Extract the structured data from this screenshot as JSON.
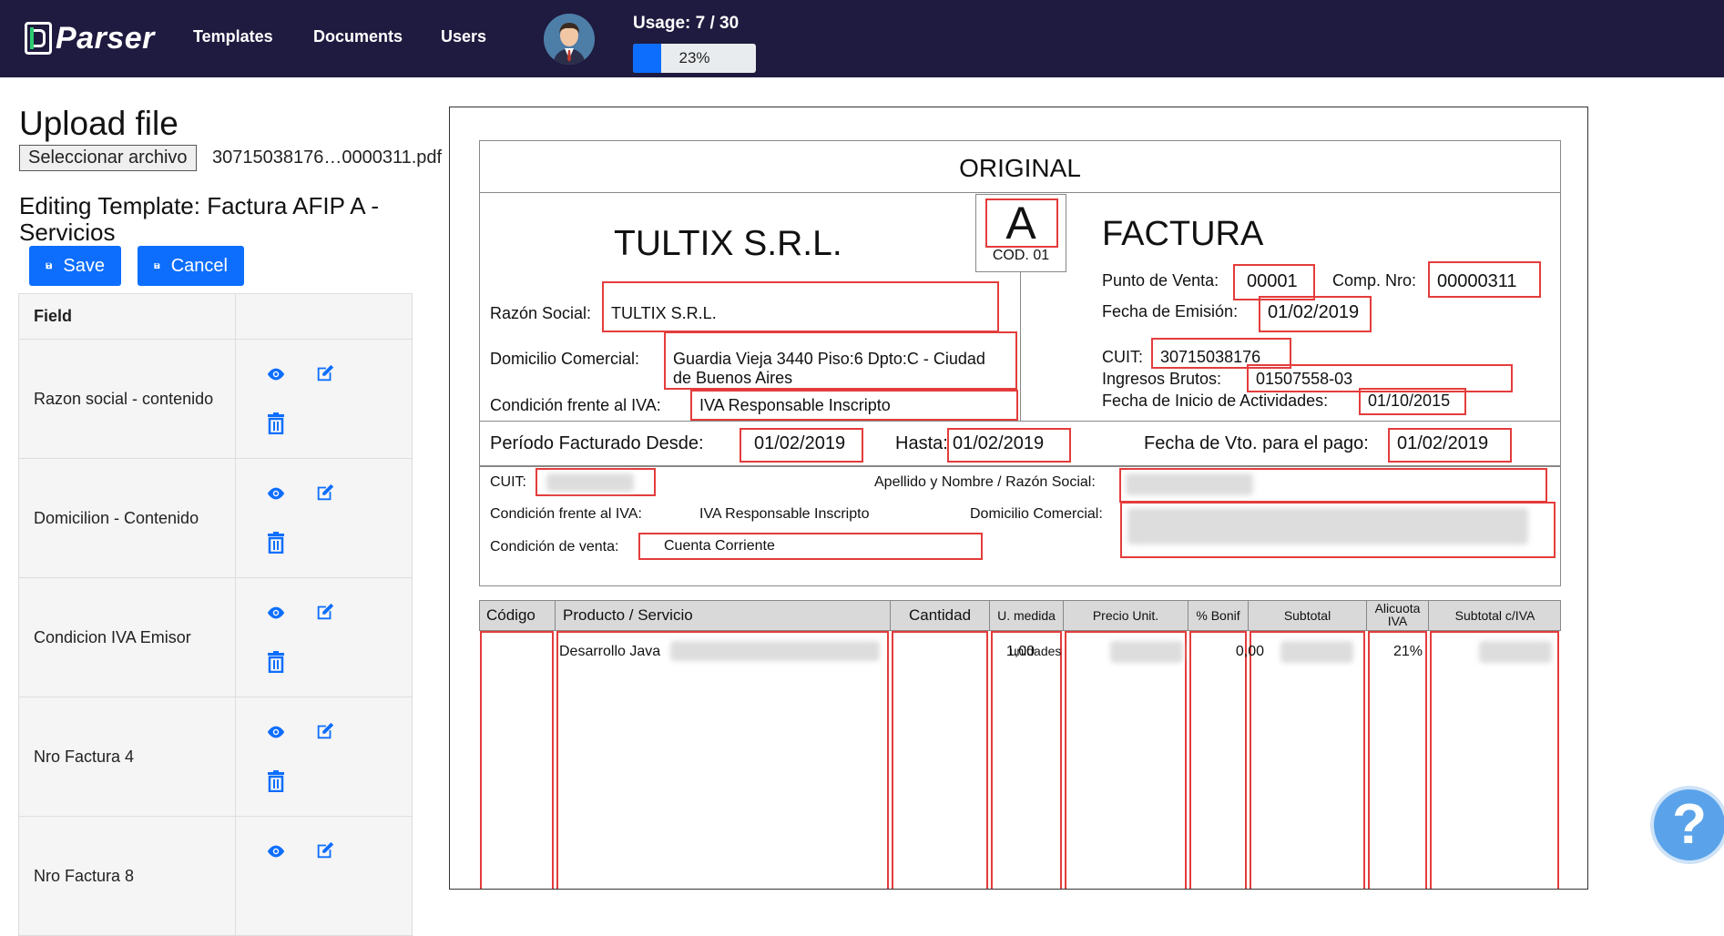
{
  "nav": {
    "logo": "Parser",
    "links": [
      "Templates",
      "Documents",
      "Users"
    ],
    "usage": "Usage: 7 / 30",
    "progress_percent": 23,
    "progress_label": "23%"
  },
  "upload": {
    "title": "Upload file",
    "button": "Seleccionar archivo",
    "file_name": "30715038176…0000311.pdf"
  },
  "editor": {
    "title": "Editing Template: Factura AFIP A - Servicios",
    "save": "Save",
    "cancel": "Cancel",
    "table_header": "Field",
    "fields": [
      "Razon social - contenido",
      "Domicilion - Contenido",
      "Condicion IVA Emisor",
      "Nro Factura 4",
      "Nro Factura 8"
    ]
  },
  "invoice": {
    "original": "ORIGINAL",
    "letter": "A",
    "cod": "COD. 01",
    "company": "TULTIX S.R.L.",
    "doc_type": "FACTURA",
    "razon_social_label": "Razón Social:",
    "razon_social": "TULTIX S.R.L.",
    "domicilio_label": "Domicilio Comercial:",
    "domicilio_1": "Guardia Vieja 3440 Piso:6 Dpto:C - Ciudad",
    "domicilio_2": "de Buenos Aires",
    "cond_iva_label": "Condición frente al IVA:",
    "cond_iva": "IVA Responsable Inscripto",
    "punto_venta_label": "Punto de Venta:",
    "punto_venta": "00001",
    "comp_nro_label": "Comp. Nro:",
    "comp_nro": "00000311",
    "fecha_emision_label": "Fecha de Emisión:",
    "fecha_emision": "01/02/2019",
    "cuit_label": "CUIT:",
    "cuit": "30715038176",
    "ingresos_label": "Ingresos Brutos:",
    "ingresos": "01507558-03",
    "inicio_label": "Fecha de Inicio de Actividades:",
    "inicio": "01/10/2015",
    "periodo_label": "Período Facturado Desde:",
    "periodo_desde": "01/02/2019",
    "hasta_label": "Hasta:",
    "hasta": "01/02/2019",
    "vto_label": "Fecha de Vto. para el pago:",
    "vto": "01/02/2019",
    "client_cuit_label": "CUIT:",
    "client_name_label": "Apellido y Nombre / Razón Social:",
    "client_cond_label": "Condición frente al IVA:",
    "client_cond": "IVA Responsable Inscripto",
    "client_dom_label": "Domicilio Comercial:",
    "cond_venta_label": "Condición de venta:",
    "cond_venta": "Cuenta Corriente",
    "columns": [
      "Código",
      "Producto / Servicio",
      "Cantidad",
      "U. medida",
      "Precio Unit.",
      "% Bonif",
      "Subtotal",
      "Alicuota IVA",
      "Subtotal c/IVA"
    ],
    "row": {
      "producto": "Desarrollo Java",
      "cantidad": "1,00",
      "unidad": "unidades",
      "bonif": "0,00",
      "alicuota": "21%"
    }
  },
  "help": "?"
}
